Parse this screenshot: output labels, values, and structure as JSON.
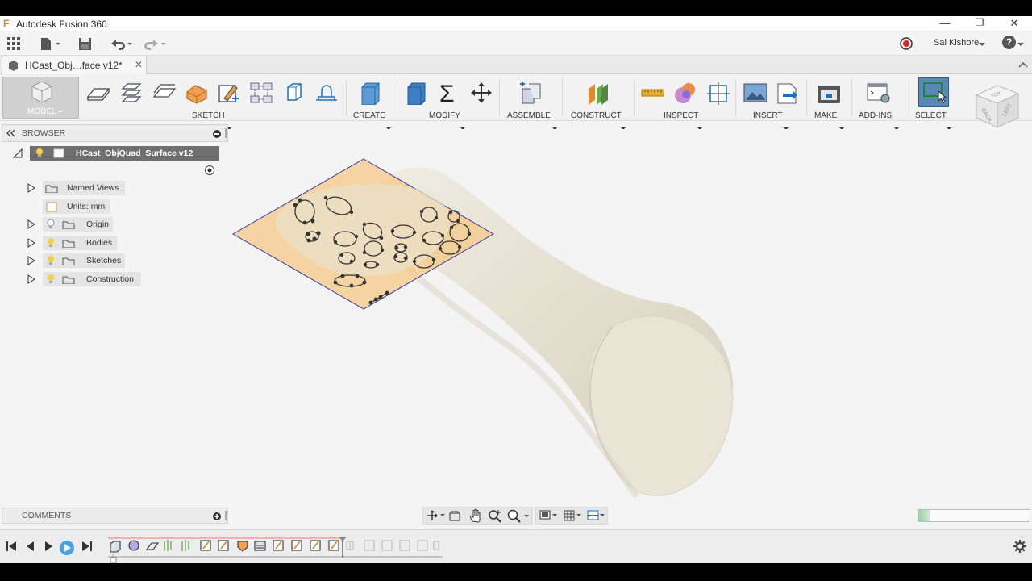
{
  "window": {
    "title": "Autodesk Fusion 360",
    "app_icon_glyph": "F",
    "minimize_glyph": "—",
    "restore_glyph": "❐",
    "close_glyph": "✕"
  },
  "quick_access": {
    "user_name": "Sai Kishore",
    "help_glyph": "?"
  },
  "document_tab": {
    "label": "HCast_Obj…face v12*",
    "close_glyph": "✕"
  },
  "toolbar": {
    "workspace": "MODEL",
    "groups": {
      "sketch": "SKETCH",
      "create": "CREATE",
      "modify": "MODIFY",
      "assemble": "ASSEMBLE",
      "construct": "CONSTRUCT",
      "inspect": "INSPECT",
      "insert": "INSERT",
      "make": "MAKE",
      "addins": "ADD-INS",
      "select": "SELECT"
    },
    "viewcube": {
      "face_top": "TOP",
      "face_back": "BACK",
      "face_left": "LEFT"
    }
  },
  "browser": {
    "title": "BROWSER",
    "root": "HCast_ObjQuad_Surface v12",
    "items": [
      {
        "label": "Named Views"
      },
      {
        "label": "Units: mm"
      },
      {
        "label": "Origin"
      },
      {
        "label": "Bodies"
      },
      {
        "label": "Sketches"
      },
      {
        "label": "Construction"
      }
    ]
  },
  "comments": {
    "title": "COMMENTS"
  },
  "progress": {
    "fill_fraction": 0.1
  },
  "colors": {
    "model_body": "#e6e2d4",
    "sketch_plane": "#f5c98a",
    "plane_edge": "#3a3aa0",
    "select_accent": "#4a7fb0"
  }
}
